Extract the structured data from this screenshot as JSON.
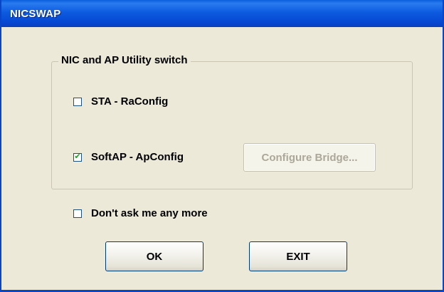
{
  "window": {
    "title": "NICSWAP"
  },
  "group": {
    "label": "NIC and AP Utility switch"
  },
  "options": {
    "sta": {
      "label": "STA - RaConfig",
      "checked": false
    },
    "softap": {
      "label": "SoftAP - ApConfig",
      "checked": true
    },
    "configure_bridge_label": "Configure Bridge...",
    "dont_ask": {
      "label": "Don't ask me any more",
      "checked": false
    }
  },
  "buttons": {
    "ok_label": "OK",
    "exit_label": "EXIT"
  },
  "colors": {
    "titlebar": "#0A5EDB",
    "window_bg": "#ECE9D8",
    "checkmark": "#21A121"
  }
}
